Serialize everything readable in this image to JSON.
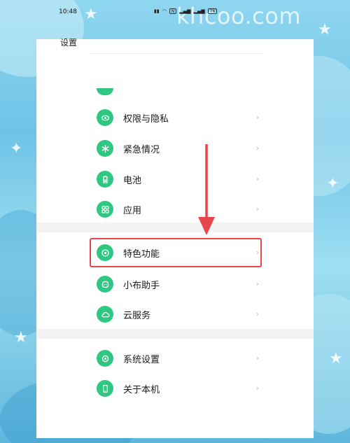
{
  "watermark": "khcoo.com",
  "status_bar": {
    "time": "10:48",
    "battery": "76"
  },
  "header": {
    "title": "设置"
  },
  "menu": {
    "items": [
      {
        "label": "权限与隐私",
        "icon": "shield-eye-icon"
      },
      {
        "label": "紧急情况",
        "icon": "asterisk-icon"
      },
      {
        "label": "电池",
        "icon": "battery-icon"
      },
      {
        "label": "应用",
        "icon": "apps-grid-icon"
      },
      {
        "label": "特色功能",
        "icon": "feature-star-icon"
      },
      {
        "label": "小布助手",
        "icon": "assistant-icon"
      },
      {
        "label": "云服务",
        "icon": "cloud-icon"
      },
      {
        "label": "系统设置",
        "icon": "system-settings-icon"
      },
      {
        "label": "关于本机",
        "icon": "phone-icon"
      }
    ]
  },
  "colors": {
    "accent": "#2ec882",
    "highlight": "#e8454d"
  }
}
